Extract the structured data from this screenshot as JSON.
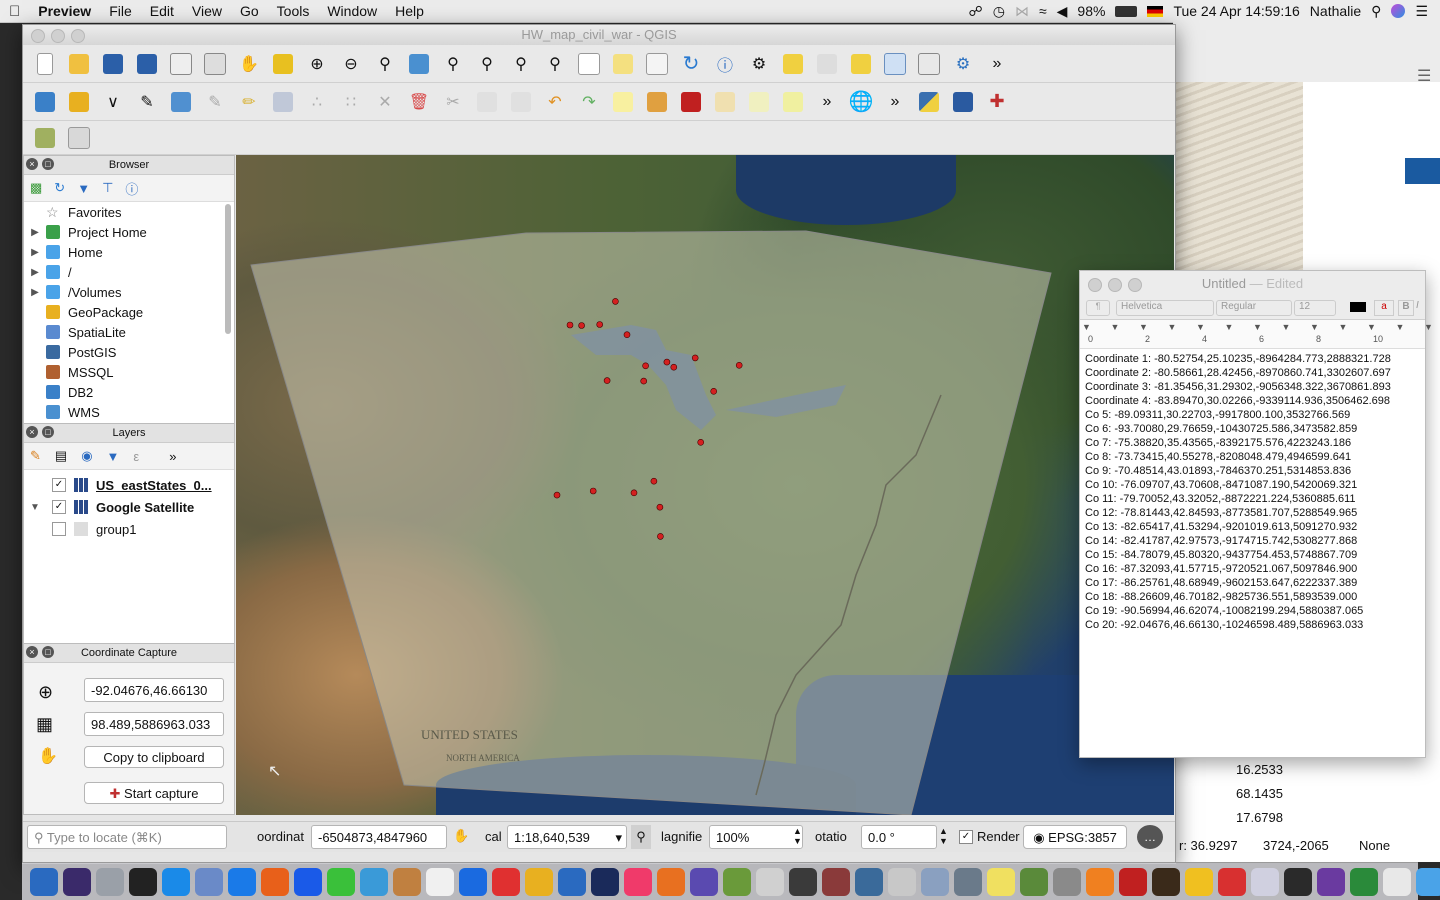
{
  "menubar": {
    "apple": "",
    "app_name": "Preview",
    "menus": [
      "File",
      "Edit",
      "View",
      "Go",
      "Tools",
      "Window",
      "Help"
    ],
    "battery": "98%",
    "datetime": "Tue 24 Apr  14:59:16",
    "user": "Nathalie"
  },
  "qgis": {
    "window_title": "HW_map_civil_war - QGIS",
    "browser": {
      "title": "Browser",
      "items": [
        {
          "label": "Favorites",
          "expandable": false,
          "icon": "star-icon"
        },
        {
          "label": "Project Home",
          "expandable": true,
          "icon": "project-home-icon"
        },
        {
          "label": "Home",
          "expandable": true,
          "icon": "folder-icon"
        },
        {
          "label": "/",
          "expandable": true,
          "icon": "folder-icon"
        },
        {
          "label": "/Volumes",
          "expandable": true,
          "icon": "folder-icon"
        },
        {
          "label": "GeoPackage",
          "expandable": false,
          "icon": "geopackage-icon"
        },
        {
          "label": "SpatiaLite",
          "expandable": false,
          "icon": "spatialite-icon"
        },
        {
          "label": "PostGIS",
          "expandable": false,
          "icon": "postgis-icon"
        },
        {
          "label": "MSSQL",
          "expandable": false,
          "icon": "mssql-icon"
        },
        {
          "label": "DB2",
          "expandable": false,
          "icon": "db2-icon"
        },
        {
          "label": "WMS",
          "expandable": false,
          "icon": "wms-icon"
        }
      ]
    },
    "layers": {
      "title": "Layers",
      "items": [
        {
          "label": "US_eastStates_0...",
          "checked": true,
          "bold": true,
          "expandable": false
        },
        {
          "label": "Google Satellite",
          "checked": true,
          "bold": true,
          "expandable": true
        },
        {
          "label": "group1",
          "checked": false,
          "bold": false,
          "expandable": false
        }
      ]
    },
    "coordinate_capture": {
      "title": "Coordinate Capture",
      "geo_value": "-92.04676,46.66130",
      "proj_value": "98.489,5886963.033",
      "copy_button": "Copy to clipboard",
      "start_button": "Start capture"
    },
    "map": {
      "map_title_line1": "UNITED STATES",
      "map_title_line2": "NORTH AMERICA"
    },
    "status": {
      "locate_placeholder": "Type to locate (⌘K)",
      "coord_label": "oordinat",
      "coord_value": "-6504873,4847960",
      "scale_label": "cal",
      "scale_value": "1:18,640,539",
      "magnifier_label": "lagnifie",
      "magnifier_value": "100%",
      "rotation_label": "otatio",
      "rotation_value": "0.0 °",
      "render_label": "Render",
      "render_checked": true,
      "crs": "EPSG:3857"
    }
  },
  "background_app": {
    "values": [
      "16.2533",
      "68.1435",
      "17.6798"
    ],
    "status_left": "r: 36.9297",
    "status_mid": "3724,-2065",
    "status_right": "None"
  },
  "textedit": {
    "title": "Untitled",
    "subtitle": "— Edited",
    "font_name": "Helvetica",
    "font_style": "Regular",
    "font_size": "12",
    "ruler_marks": [
      "0",
      "2",
      "4",
      "6",
      "8",
      "10"
    ],
    "lines": [
      "Coordinate 1: -80.52754,25.10235,-8964284.773,2888321.728",
      "Coordinate 2: -80.58661,28.42456,-8970860.741,3302607.697",
      "Coordinate 3: -81.35456,31.29302,-9056348.322,3670861.893",
      "Coordinate 4: -83.89470,30.02266,-9339114.936,3506462.698",
      "Co 5: -89.09311,30.22703,-9917800.100,3532766.569",
      "Co 6: -93.70080,29.76659,-10430725.586,3473582.859",
      "Co 7: -75.38820,35.43565,-8392175.576,4223243.186",
      "Co 8: -73.73415,40.55278,-8208048.479,4946599.641",
      "Co 9: -70.48514,43.01893,-7846370.251,5314853.836",
      "Co 10: -76.09707,43.70608,-8471087.190,5420069.321",
      "Co 11: -79.70052,43.32052,-8872221.224,5360885.611",
      "Co 12: -78.81443,42.84593,-8773581.707,5288549.965",
      "Co 13: -82.65417,41.53294,-9201019.613,5091270.932",
      "Co 14: -82.41787,42.97573,-9174715.742,5308277.868",
      "Co 15: -84.78079,45.80320,-9437754.453,5748867.709",
      "Co 16: -87.32093,41.57715,-9720521.067,5097846.900",
      "Co 17: -86.25761,48.68949,-9602153.647,6222337.389",
      "Co 18: -88.26609,46.70182,-9825736.551,5893539.000",
      "Co 19: -90.56994,46.62074,-10082199.294,5880387.065",
      "Co 20: -92.04676,46.66130,-10246598.489,5886963.033"
    ]
  },
  "captured_points": {
    "projected": [
      [
        -8964284.773,
        2888321.728
      ],
      [
        -8970860.741,
        3302607.697
      ],
      [
        -9056348.322,
        3670861.893
      ],
      [
        -9339114.936,
        3506462.698
      ],
      [
        -9917800.1,
        3532766.569
      ],
      [
        -10430725.586,
        3473582.859
      ],
      [
        -8392175.576,
        4223243.186
      ],
      [
        -8208048.479,
        4946599.641
      ],
      [
        -7846370.251,
        5314853.836
      ],
      [
        -8471087.19,
        5420069.321
      ],
      [
        -8872221.224,
        5360885.611
      ],
      [
        -8773581.707,
        5288549.965
      ],
      [
        -9201019.613,
        5091270.932
      ],
      [
        -9174715.742,
        5308277.868
      ],
      [
        -9437754.453,
        5748867.709
      ],
      [
        -9720521.067,
        5097846.9
      ],
      [
        -9602153.647,
        6222337.389
      ],
      [
        -9825736.551,
        5893539.0
      ],
      [
        -10082199.294,
        5880387.065
      ],
      [
        -10246598.489,
        5886963.033
      ]
    ],
    "color": "#d42020"
  },
  "colors": {
    "menubar_bg": "#ececec",
    "panel_bg": "#f3f3f3",
    "point": "#d42020",
    "sea": "#1e3f72"
  }
}
